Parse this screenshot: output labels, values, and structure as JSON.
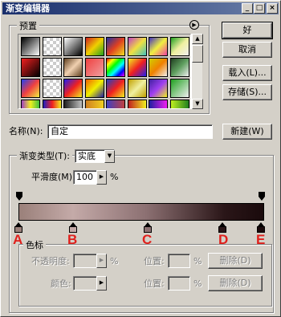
{
  "window": {
    "title": "渐变编辑器",
    "minimize": "_",
    "maximize": "□",
    "close": "×"
  },
  "presets": {
    "label": "预置",
    "menu_icon": "arrow-right-circle-icon",
    "swatches": [
      "linear-gradient(135deg,#000,#fff)",
      "repeating-conic-gradient(#fff 0 25%,#ccc 0 50%) 0 0/8px 8px",
      "linear-gradient(135deg,#fff,#000)",
      "linear-gradient(135deg,#d02020,#f0d000,#20a020)",
      "linear-gradient(135deg,#2030a0,#e04020,#f0e020)",
      "linear-gradient(135deg,#c040c0,#f0e040,#40c0c0)",
      "linear-gradient(135deg,#4030c0,#f0f040,#f040a0)",
      "linear-gradient(135deg,#20a020,#f0f0a0,#f0f0f0)",
      "linear-gradient(135deg,#f02020,#000)",
      "repeating-conic-gradient(#fff 0 25%,#ccc 0 50%) 0 0/8px 8px",
      "linear-gradient(135deg,#604020,#f0d0b0,#604020)",
      "linear-gradient(135deg,#f04040,#f0a0a0)",
      "linear-gradient(135deg,#ff0000,#ffff00,#00ff00,#00ffff,#0000ff,#ff00ff)",
      "linear-gradient(135deg,#f0f020,#f02020,#2020f0)",
      "linear-gradient(135deg,#d0d000,#f08000,#f0f0f0)",
      "linear-gradient(135deg,#204020,#60a060,#f0f0f0)",
      "linear-gradient(135deg,#2040f0,#f04040,#f0f040)",
      "repeating-conic-gradient(#fff 0 25%,#ccc 0 50%) 0 0/8px 8px",
      "linear-gradient(135deg,#2020f0,#f02020,#f0f020)",
      "linear-gradient(135deg,#f06000,#f0f000,#2020a0)",
      "linear-gradient(135deg,#2040c0,#f02020,#f0f020)",
      "linear-gradient(135deg,#c0a000,#f0f0a0,#c0a000)",
      "linear-gradient(135deg,#4020a0,#a040f0,#f0f020)",
      "linear-gradient(135deg,#20a020,#f0f0f0)",
      "linear-gradient(90deg,#a040c0,#f0f020,#40c040)",
      "linear-gradient(90deg,#2020c0,#f02020,#f0f020)",
      "linear-gradient(90deg,#202020,#c0c0c0)",
      "linear-gradient(90deg,#d08020,#f0d020)",
      "linear-gradient(90deg,#4040c0,#c04040)",
      "linear-gradient(90deg,#c02020,#f0f020)",
      "linear-gradient(90deg,#2020a0,#f020f0)",
      "linear-gradient(90deg,#c0f020,#208020)"
    ]
  },
  "buttons": {
    "ok": "好",
    "cancel": "取消",
    "load": "载入(L)...",
    "save": "存储(S)...",
    "new": "新建(W)"
  },
  "name": {
    "label": "名称(N):",
    "value": "自定"
  },
  "gradient_type": {
    "label": "渐变类型(T):",
    "value": "实底"
  },
  "smoothness": {
    "label": "平滑度(M):",
    "value": "100",
    "unit": "%"
  },
  "stop_markers": [
    "A",
    "B",
    "C",
    "D",
    "E"
  ],
  "color_stops": {
    "label": "色标",
    "opacity_label": "不透明度:",
    "opacity_unit": "%",
    "location_label_1": "位置:",
    "location_unit_1": "%",
    "delete_1": "删除(D)",
    "color_label": "颜色:",
    "location_label_2": "位置:",
    "location_unit_2": "%",
    "delete_2": "删除(D)"
  }
}
